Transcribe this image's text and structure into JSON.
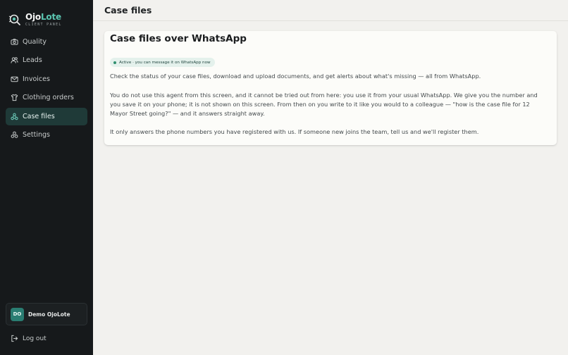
{
  "brand": {
    "name_part1": "Ojo",
    "name_part2": "Lote",
    "subtitle": "CLIENT PANEL"
  },
  "nav": [
    {
      "label": "Quality",
      "icon": "camera-icon"
    },
    {
      "label": "Leads",
      "icon": "users-icon"
    },
    {
      "label": "Invoices",
      "icon": "mail-icon"
    },
    {
      "label": "Clothing orders",
      "icon": "shirt-icon"
    },
    {
      "label": "Case files",
      "icon": "folder-network-icon",
      "active": true
    },
    {
      "label": "Settings",
      "icon": "settings-icon"
    }
  ],
  "user": {
    "initials": "DO",
    "name": "Demo OjoLote"
  },
  "logout_label": "Log out",
  "header": {
    "title": "Case files"
  },
  "card": {
    "title": "Case files over WhatsApp",
    "badge": "Active · you can message it on WhatsApp now",
    "para1": "Check the status of your case files, download and upload documents, and get alerts about what's missing — all from WhatsApp.",
    "para2": "You do not use this agent from this screen, and it cannot be tried out from here: you use it from your usual WhatsApp. We give you the number and you save it on your phone; it is not shown on this screen. From then on you write to it like you would to a colleague — \"how is the case file for 12 Mayor Street going?\" — and it answers straight away.",
    "para3": "It only answers the phone numbers you have registered with us. If someone new joins the team, tell us and we'll register them."
  },
  "colors": {
    "sidebar_bg": "#16191b",
    "accent": "#5bc6b1",
    "active_bg": "#1f3a38",
    "badge_bg": "#e4f1ec",
    "status_dot": "#2f8f6e"
  }
}
